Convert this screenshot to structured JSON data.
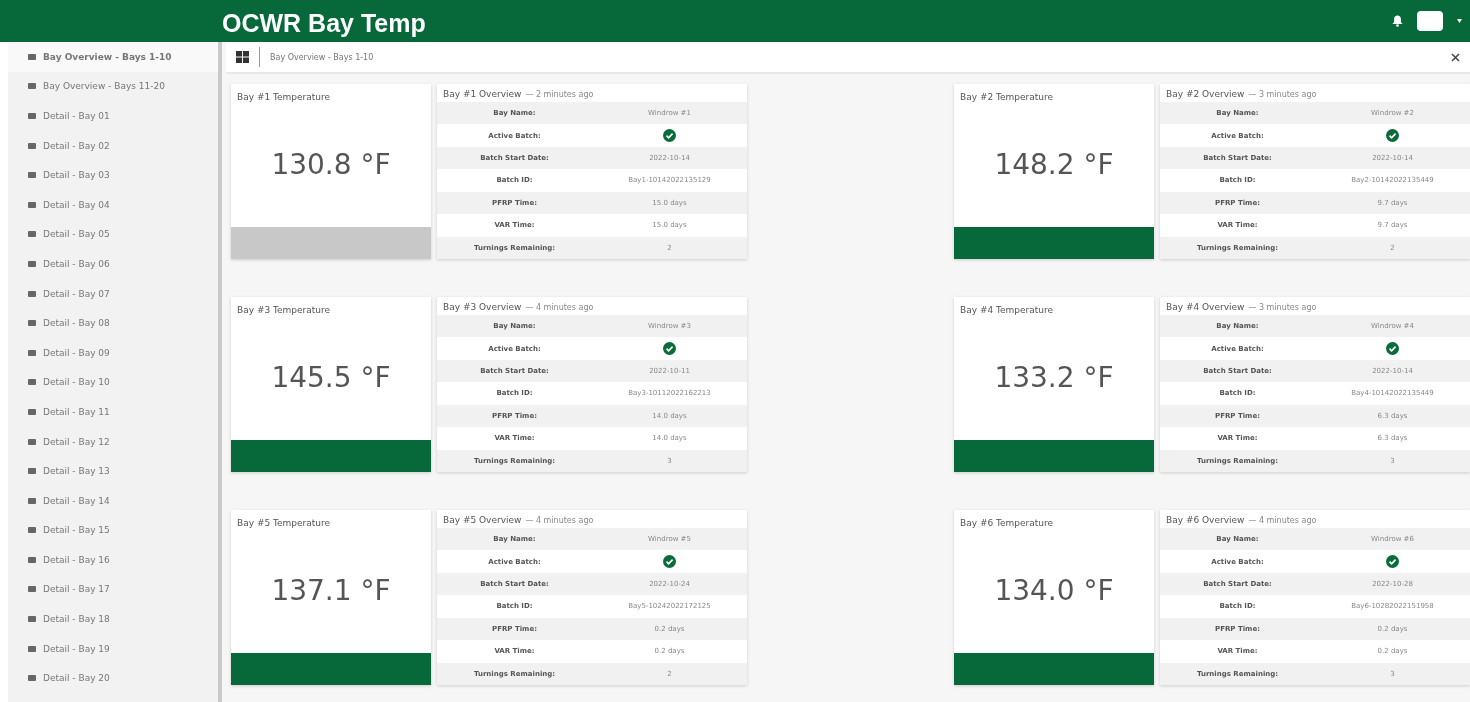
{
  "header": {
    "title": "OCWR Bay Temp"
  },
  "sidebar": {
    "items": [
      {
        "label": "Bay Overview - Bays 1-10",
        "selected": true
      },
      {
        "label": "Bay Overview - Bays 11-20",
        "selected": false
      },
      {
        "label": "Detail - Bay 01",
        "selected": false
      },
      {
        "label": "Detail - Bay 02",
        "selected": false
      },
      {
        "label": "Detail - Bay 03",
        "selected": false
      },
      {
        "label": "Detail - Bay 04",
        "selected": false
      },
      {
        "label": "Detail - Bay 05",
        "selected": false
      },
      {
        "label": "Detail - Bay 06",
        "selected": false
      },
      {
        "label": "Detail - Bay 07",
        "selected": false
      },
      {
        "label": "Detail - Bay 08",
        "selected": false
      },
      {
        "label": "Detail - Bay 09",
        "selected": false
      },
      {
        "label": "Detail - Bay 10",
        "selected": false
      },
      {
        "label": "Detail - Bay 11",
        "selected": false
      },
      {
        "label": "Detail - Bay 12",
        "selected": false
      },
      {
        "label": "Detail - Bay 13",
        "selected": false
      },
      {
        "label": "Detail - Bay 14",
        "selected": false
      },
      {
        "label": "Detail - Bay 15",
        "selected": false
      },
      {
        "label": "Detail - Bay 16",
        "selected": false
      },
      {
        "label": "Detail - Bay 17",
        "selected": false
      },
      {
        "label": "Detail - Bay 18",
        "selected": false
      },
      {
        "label": "Detail - Bay 19",
        "selected": false
      },
      {
        "label": "Detail - Bay 20",
        "selected": false
      }
    ]
  },
  "toolbar": {
    "breadcrumb": "Bay Overview - Bays 1-10"
  },
  "bays": [
    {
      "temp_title": "Bay #1 Temperature",
      "temperature": "130.8 °F",
      "color": "#c8c8c8",
      "overview_title": "Bay #1 Overview",
      "updated": "— 2 minutes ago",
      "rows": [
        {
          "label": "Bay Name:",
          "value": "Windrow #1"
        },
        {
          "label": "Active Batch:",
          "kind": "check",
          "active": true
        },
        {
          "label": "Batch Start Date:",
          "value": "2022-10-14"
        },
        {
          "label": "Batch ID:",
          "value": "Bay1-10142022135129"
        },
        {
          "label": "PFRP Time:",
          "value": "15.0 days"
        },
        {
          "label": "VAR Time:",
          "value": "15.0 days"
        },
        {
          "label": "Turnings Remaining:",
          "value": "2"
        }
      ]
    },
    {
      "temp_title": "Bay #2 Temperature",
      "temperature": "148.2 °F",
      "color": "#07693a",
      "overview_title": "Bay #2 Overview",
      "updated": "— 3 minutes ago",
      "rows": [
        {
          "label": "Bay Name:",
          "value": "Windrow #2"
        },
        {
          "label": "Active Batch:",
          "kind": "check",
          "active": true
        },
        {
          "label": "Batch Start Date:",
          "value": "2022-10-14"
        },
        {
          "label": "Batch ID:",
          "value": "Bay2-10142022135449"
        },
        {
          "label": "PFRP Time:",
          "value": "9.7 days"
        },
        {
          "label": "VAR Time:",
          "value": "9.7 days"
        },
        {
          "label": "Turnings Remaining:",
          "value": "2"
        }
      ]
    },
    {
      "temp_title": "Bay #3 Temperature",
      "temperature": "145.5 °F",
      "color": "#07693a",
      "overview_title": "Bay #3 Overview",
      "updated": "— 4 minutes ago",
      "rows": [
        {
          "label": "Bay Name:",
          "value": "Windrow #3"
        },
        {
          "label": "Active Batch:",
          "kind": "check",
          "active": true
        },
        {
          "label": "Batch Start Date:",
          "value": "2022-10-11"
        },
        {
          "label": "Batch ID:",
          "value": "Bay3-10112022162213"
        },
        {
          "label": "PFRP Time:",
          "value": "14.0 days"
        },
        {
          "label": "VAR Time:",
          "value": "14.0 days"
        },
        {
          "label": "Turnings Remaining:",
          "value": "3"
        }
      ]
    },
    {
      "temp_title": "Bay #4 Temperature",
      "temperature": "133.2 °F",
      "color": "#07693a",
      "overview_title": "Bay #4 Overview",
      "updated": "— 3 minutes ago",
      "rows": [
        {
          "label": "Bay Name:",
          "value": "Windrow #4"
        },
        {
          "label": "Active Batch:",
          "kind": "check",
          "active": true
        },
        {
          "label": "Batch Start Date:",
          "value": "2022-10-14"
        },
        {
          "label": "Batch ID:",
          "value": "Bay4-10142022135449"
        },
        {
          "label": "PFRP Time:",
          "value": "6.3 days"
        },
        {
          "label": "VAR Time:",
          "value": "6.3 days"
        },
        {
          "label": "Turnings Remaining:",
          "value": "3"
        }
      ]
    },
    {
      "temp_title": "Bay #5 Temperature",
      "temperature": "137.1 °F",
      "color": "#07693a",
      "overview_title": "Bay #5 Overview",
      "updated": "— 4 minutes ago",
      "rows": [
        {
          "label": "Bay Name:",
          "value": "Windrow #5"
        },
        {
          "label": "Active Batch:",
          "kind": "check",
          "active": true
        },
        {
          "label": "Batch Start Date:",
          "value": "2022-10-24"
        },
        {
          "label": "Batch ID:",
          "value": "Bay5-10242022172125"
        },
        {
          "label": "PFRP Time:",
          "value": "0.2 days"
        },
        {
          "label": "VAR Time:",
          "value": "0.2 days"
        },
        {
          "label": "Turnings Remaining:",
          "value": "2"
        }
      ]
    },
    {
      "temp_title": "Bay #6 Temperature",
      "temperature": "134.0 °F",
      "color": "#07693a",
      "overview_title": "Bay #6 Overview",
      "updated": "— 4 minutes ago",
      "rows": [
        {
          "label": "Bay Name:",
          "value": "Windrow #6"
        },
        {
          "label": "Active Batch:",
          "kind": "check",
          "active": true
        },
        {
          "label": "Batch Start Date:",
          "value": "2022-10-28"
        },
        {
          "label": "Batch ID:",
          "value": "Bay6-10282022151958"
        },
        {
          "label": "PFRP Time:",
          "value": "0.2 days"
        },
        {
          "label": "VAR Time:",
          "value": "0.2 days"
        },
        {
          "label": "Turnings Remaining:",
          "value": "3"
        }
      ]
    }
  ]
}
